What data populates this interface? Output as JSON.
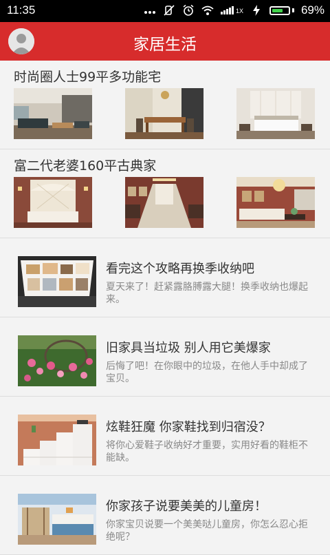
{
  "status_bar": {
    "time": "11:35",
    "icons": [
      "more-dots-icon",
      "mute-icon",
      "alarm-icon",
      "wifi-icon",
      "signal-icon",
      "charging-icon"
    ],
    "network_label": "1X",
    "battery_percent": "69%",
    "battery_level": 0.69
  },
  "app_bar": {
    "title": "家居生活",
    "avatar_icon": "user-avatar-icon"
  },
  "galleries": [
    {
      "title": "时尚圈人士99平多功能宅"
    },
    {
      "title": "富二代老婆160平古典家"
    }
  ],
  "articles": [
    {
      "title": "看完这个攻略再换季收纳吧",
      "desc": "夏天来了！赶紧露胳膊露大腿！换季收纳也爆起来。"
    },
    {
      "title": "旧家具当垃圾 别人用它美爆家",
      "desc": "后悔了吧！在你眼中的垃圾，在他人手中却成了宝贝。"
    },
    {
      "title": "炫鞋狂魔 你家鞋找到归宿没？",
      "desc": "将你心爱鞋子收纳好才重要，实用好看的鞋柜不能缺。"
    },
    {
      "title": "你家孩子说要美美的儿童房！",
      "desc": "你家宝贝说要一个美美哒儿童房，你怎么忍心拒绝呢？"
    }
  ],
  "colors": {
    "app_bar": "#d72c2c",
    "background": "#f3f3f3",
    "battery": "#42d14c"
  }
}
